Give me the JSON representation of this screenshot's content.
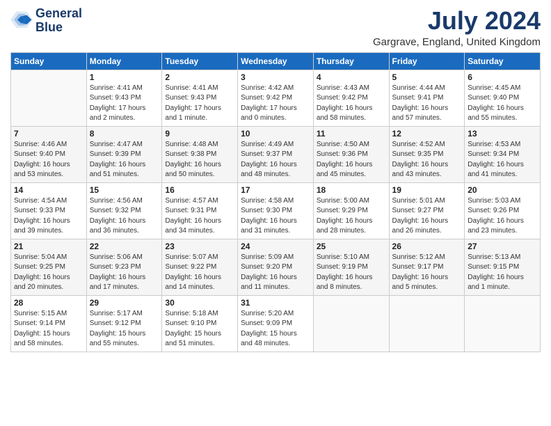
{
  "header": {
    "logo_line1": "General",
    "logo_line2": "Blue",
    "month": "July 2024",
    "location": "Gargrave, England, United Kingdom"
  },
  "days_of_week": [
    "Sunday",
    "Monday",
    "Tuesday",
    "Wednesday",
    "Thursday",
    "Friday",
    "Saturday"
  ],
  "weeks": [
    [
      {
        "day": "",
        "info": ""
      },
      {
        "day": "1",
        "info": "Sunrise: 4:41 AM\nSunset: 9:43 PM\nDaylight: 17 hours\nand 2 minutes."
      },
      {
        "day": "2",
        "info": "Sunrise: 4:41 AM\nSunset: 9:43 PM\nDaylight: 17 hours\nand 1 minute."
      },
      {
        "day": "3",
        "info": "Sunrise: 4:42 AM\nSunset: 9:42 PM\nDaylight: 17 hours\nand 0 minutes."
      },
      {
        "day": "4",
        "info": "Sunrise: 4:43 AM\nSunset: 9:42 PM\nDaylight: 16 hours\nand 58 minutes."
      },
      {
        "day": "5",
        "info": "Sunrise: 4:44 AM\nSunset: 9:41 PM\nDaylight: 16 hours\nand 57 minutes."
      },
      {
        "day": "6",
        "info": "Sunrise: 4:45 AM\nSunset: 9:40 PM\nDaylight: 16 hours\nand 55 minutes."
      }
    ],
    [
      {
        "day": "7",
        "info": "Sunrise: 4:46 AM\nSunset: 9:40 PM\nDaylight: 16 hours\nand 53 minutes."
      },
      {
        "day": "8",
        "info": "Sunrise: 4:47 AM\nSunset: 9:39 PM\nDaylight: 16 hours\nand 51 minutes."
      },
      {
        "day": "9",
        "info": "Sunrise: 4:48 AM\nSunset: 9:38 PM\nDaylight: 16 hours\nand 50 minutes."
      },
      {
        "day": "10",
        "info": "Sunrise: 4:49 AM\nSunset: 9:37 PM\nDaylight: 16 hours\nand 48 minutes."
      },
      {
        "day": "11",
        "info": "Sunrise: 4:50 AM\nSunset: 9:36 PM\nDaylight: 16 hours\nand 45 minutes."
      },
      {
        "day": "12",
        "info": "Sunrise: 4:52 AM\nSunset: 9:35 PM\nDaylight: 16 hours\nand 43 minutes."
      },
      {
        "day": "13",
        "info": "Sunrise: 4:53 AM\nSunset: 9:34 PM\nDaylight: 16 hours\nand 41 minutes."
      }
    ],
    [
      {
        "day": "14",
        "info": "Sunrise: 4:54 AM\nSunset: 9:33 PM\nDaylight: 16 hours\nand 39 minutes."
      },
      {
        "day": "15",
        "info": "Sunrise: 4:56 AM\nSunset: 9:32 PM\nDaylight: 16 hours\nand 36 minutes."
      },
      {
        "day": "16",
        "info": "Sunrise: 4:57 AM\nSunset: 9:31 PM\nDaylight: 16 hours\nand 34 minutes."
      },
      {
        "day": "17",
        "info": "Sunrise: 4:58 AM\nSunset: 9:30 PM\nDaylight: 16 hours\nand 31 minutes."
      },
      {
        "day": "18",
        "info": "Sunrise: 5:00 AM\nSunset: 9:29 PM\nDaylight: 16 hours\nand 28 minutes."
      },
      {
        "day": "19",
        "info": "Sunrise: 5:01 AM\nSunset: 9:27 PM\nDaylight: 16 hours\nand 26 minutes."
      },
      {
        "day": "20",
        "info": "Sunrise: 5:03 AM\nSunset: 9:26 PM\nDaylight: 16 hours\nand 23 minutes."
      }
    ],
    [
      {
        "day": "21",
        "info": "Sunrise: 5:04 AM\nSunset: 9:25 PM\nDaylight: 16 hours\nand 20 minutes."
      },
      {
        "day": "22",
        "info": "Sunrise: 5:06 AM\nSunset: 9:23 PM\nDaylight: 16 hours\nand 17 minutes."
      },
      {
        "day": "23",
        "info": "Sunrise: 5:07 AM\nSunset: 9:22 PM\nDaylight: 16 hours\nand 14 minutes."
      },
      {
        "day": "24",
        "info": "Sunrise: 5:09 AM\nSunset: 9:20 PM\nDaylight: 16 hours\nand 11 minutes."
      },
      {
        "day": "25",
        "info": "Sunrise: 5:10 AM\nSunset: 9:19 PM\nDaylight: 16 hours\nand 8 minutes."
      },
      {
        "day": "26",
        "info": "Sunrise: 5:12 AM\nSunset: 9:17 PM\nDaylight: 16 hours\nand 5 minutes."
      },
      {
        "day": "27",
        "info": "Sunrise: 5:13 AM\nSunset: 9:15 PM\nDaylight: 16 hours\nand 1 minute."
      }
    ],
    [
      {
        "day": "28",
        "info": "Sunrise: 5:15 AM\nSunset: 9:14 PM\nDaylight: 15 hours\nand 58 minutes."
      },
      {
        "day": "29",
        "info": "Sunrise: 5:17 AM\nSunset: 9:12 PM\nDaylight: 15 hours\nand 55 minutes."
      },
      {
        "day": "30",
        "info": "Sunrise: 5:18 AM\nSunset: 9:10 PM\nDaylight: 15 hours\nand 51 minutes."
      },
      {
        "day": "31",
        "info": "Sunrise: 5:20 AM\nSunset: 9:09 PM\nDaylight: 15 hours\nand 48 minutes."
      },
      {
        "day": "",
        "info": ""
      },
      {
        "day": "",
        "info": ""
      },
      {
        "day": "",
        "info": ""
      }
    ]
  ]
}
